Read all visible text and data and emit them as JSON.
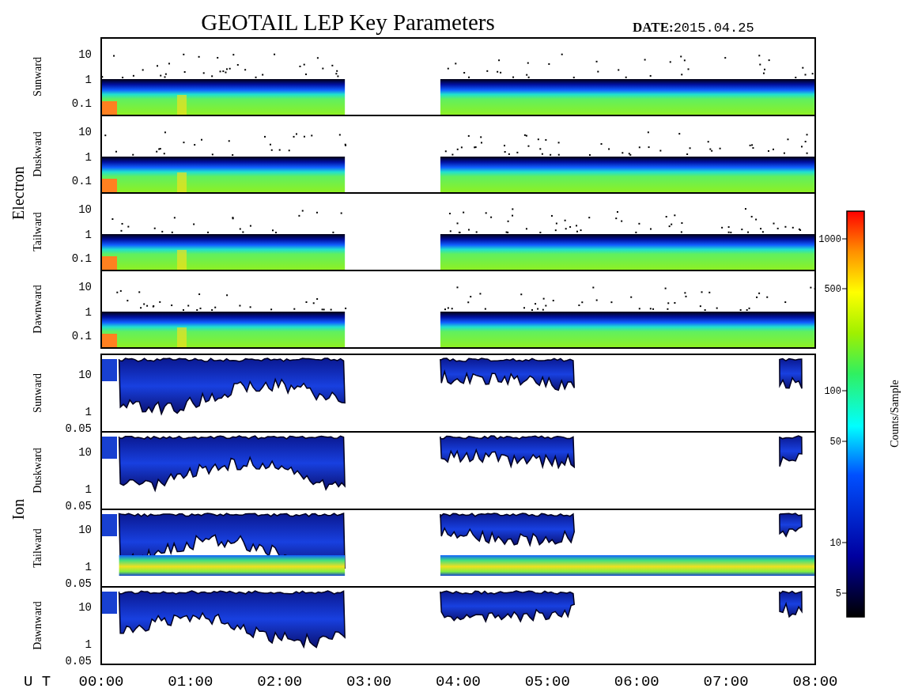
{
  "title": "GEOTAIL LEP Key Parameters",
  "date_label": "DATE:",
  "date": "2015.04.25",
  "species": [
    {
      "name": "Electron",
      "kind": "electron",
      "panels": [
        {
          "label": "Sunward",
          "yticks": [
            "10",
            "1",
            "0.1"
          ]
        },
        {
          "label": "Duskward",
          "yticks": [
            "10",
            "1",
            "0.1"
          ]
        },
        {
          "label": "Tailward",
          "yticks": [
            "10",
            "1",
            "0.1"
          ]
        },
        {
          "label": "Dawnward",
          "yticks": [
            "10",
            "1",
            "0.1"
          ]
        }
      ]
    },
    {
      "name": "Ion",
      "kind": "ion",
      "panels": [
        {
          "label": "Sunward",
          "yticks": [
            "10",
            "1",
            "0.05"
          ]
        },
        {
          "label": "Duskward",
          "yticks": [
            "10",
            "1",
            "0.05"
          ]
        },
        {
          "label": "Tailward",
          "yticks": [
            "10",
            "1",
            "0.05"
          ]
        },
        {
          "label": "Dawnward",
          "yticks": [
            "10",
            "1",
            "0.05"
          ]
        }
      ]
    }
  ],
  "x_axis": {
    "label": "U T",
    "ticks": [
      "00:00",
      "01:00",
      "02:00",
      "03:00",
      "04:00",
      "05:00",
      "06:00",
      "07:00",
      "08:00"
    ]
  },
  "colorbar": {
    "label": "Counts/Sample",
    "ticks": [
      "1000",
      "500",
      "100",
      "50",
      "10",
      "5"
    ]
  }
}
